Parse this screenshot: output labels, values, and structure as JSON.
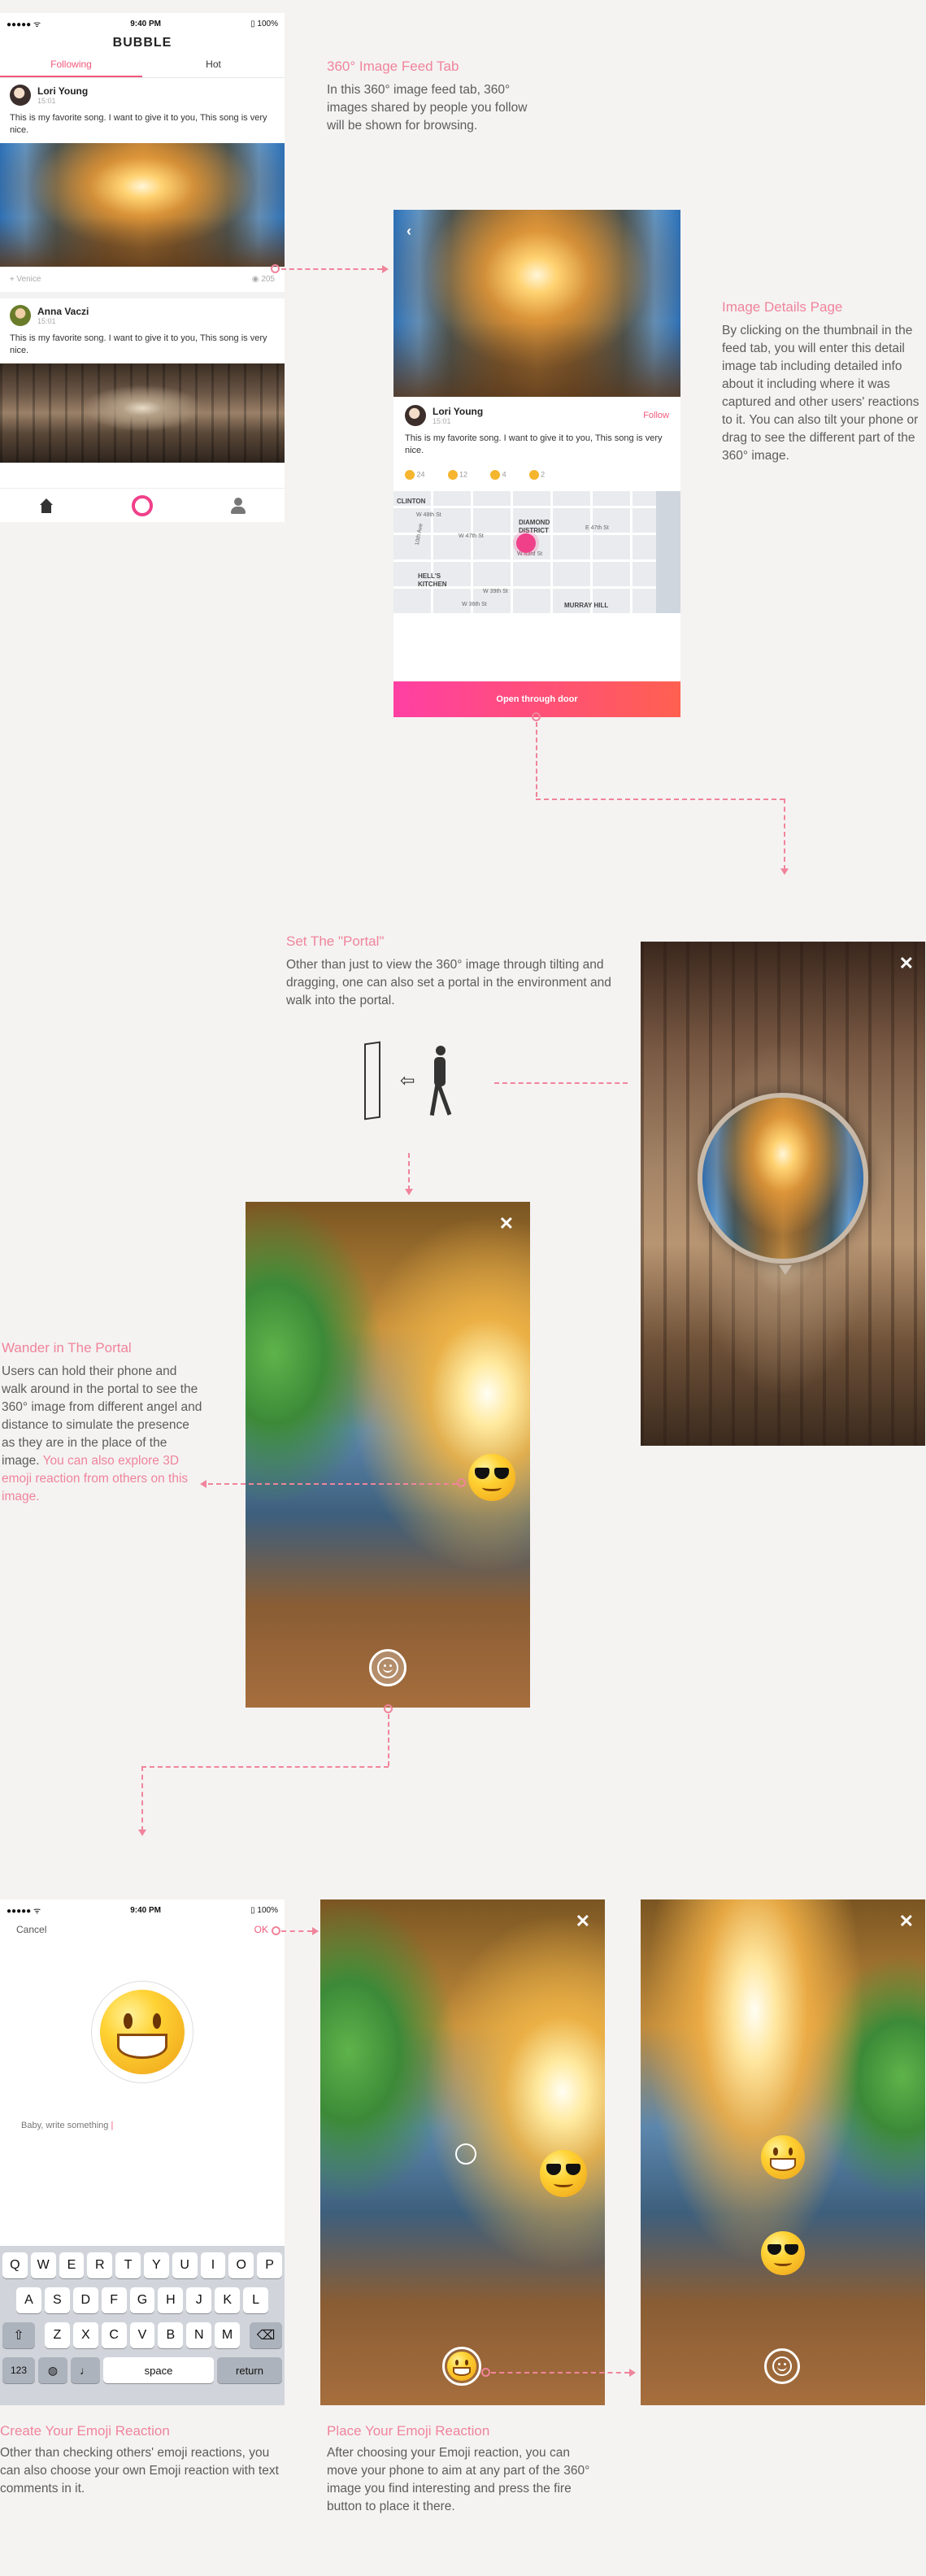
{
  "colors": {
    "accent": "#f0849b",
    "hot": "#f0597c",
    "gradient_start": "#ff3fa3",
    "gradient_end": "#ff6050",
    "background": "#f4f3f2"
  },
  "status_bar": {
    "signal": "●●●●● ᯤ",
    "time": "9:40 PM",
    "battery": "100%"
  },
  "feed": {
    "app_title": "BUBBLE",
    "tabs": [
      {
        "label": "Following",
        "active": true
      },
      {
        "label": "Hot",
        "active": false
      }
    ],
    "posts": [
      {
        "author": "Lori Young",
        "time": "15:01",
        "text": "This is my favorite song. I want to give it to you,  This song is very nice.",
        "location": "Venice",
        "views": "205"
      },
      {
        "author": "Anna Vaczi",
        "time": "15:01",
        "text": "This is my favorite song. I want to give it to you,  This song is very nice."
      }
    ],
    "nav": {
      "home_icon": "home-icon",
      "camera_icon": "record-icon",
      "profile_icon": "profile-icon"
    }
  },
  "feed_note": {
    "title": "360° Image Feed Tab",
    "body": "In this 360° image feed tab, 360° images shared by people you follow will be shown for browsing."
  },
  "detail": {
    "author": "Lori Young",
    "time": "15:01",
    "follow": "Follow",
    "text": "This is my favorite song. I want to give it to you,  This song is very nice.",
    "reactions": [
      {
        "icon": "heart-eyes-emoji",
        "count": "24"
      },
      {
        "icon": "surprised-emoji",
        "count": "12"
      },
      {
        "icon": "smirk-emoji",
        "count": "4"
      },
      {
        "icon": "laughing-emoji",
        "count": "2"
      }
    ],
    "map_labels": [
      "CLINTON",
      "W 48th St",
      "W 47th St",
      "DIAMOND DISTRICT",
      "E 47th St",
      "10th Ave",
      "W 43rd St",
      "HELL'S KITCHEN",
      "W 39th St",
      "W 36th St",
      "MURRAY HILL"
    ],
    "cta": "Open through door"
  },
  "detail_note": {
    "title": "Image Details Page",
    "body": "By clicking on the thumbnail in the feed tab, you will enter this detail image tab including detailed info about it including where it was captured and other users' reactions to it. You can also tilt your phone or drag to see the different part of the 360° image."
  },
  "portal_note": {
    "title": "Set The \"Portal\"",
    "body": "Other than just to view the 360° image through tilting and dragging, one can also set a portal in the environment and walk into the portal."
  },
  "wander_note": {
    "title": "Wander in The Portal",
    "body": "Users can hold their phone and walk around in the portal to see the 360° image from different angel and distance to simulate the presence as they are in the place of the image.",
    "highlight": "You can also explore 3D emoji reaction from others on this image."
  },
  "compose": {
    "cancel": "Cancel",
    "ok": "OK",
    "placeholder": "Baby, write something "
  },
  "keyboard": {
    "row1": [
      "Q",
      "W",
      "E",
      "R",
      "T",
      "Y",
      "U",
      "I",
      "O",
      "P"
    ],
    "row2": [
      "A",
      "S",
      "D",
      "F",
      "G",
      "H",
      "J",
      "K",
      "L"
    ],
    "row3": [
      "Z",
      "X",
      "C",
      "V",
      "B",
      "N",
      "M"
    ],
    "shift": "⇧",
    "delete": "⌫",
    "num": "123",
    "globe": "🌐",
    "mic": "🎤",
    "space": "space",
    "return": "return"
  },
  "create_note": {
    "title": "Create Your Emoji Reaction",
    "body": "Other than checking others' emoji reactions, you can also choose your own Emoji reaction with text comments in it."
  },
  "place_note": {
    "title": "Place Your Emoji Reaction",
    "body": "After choosing your Emoji reaction, you can move your phone to aim at any part of the 360° image you find interesting and press the fire button to place it there."
  }
}
